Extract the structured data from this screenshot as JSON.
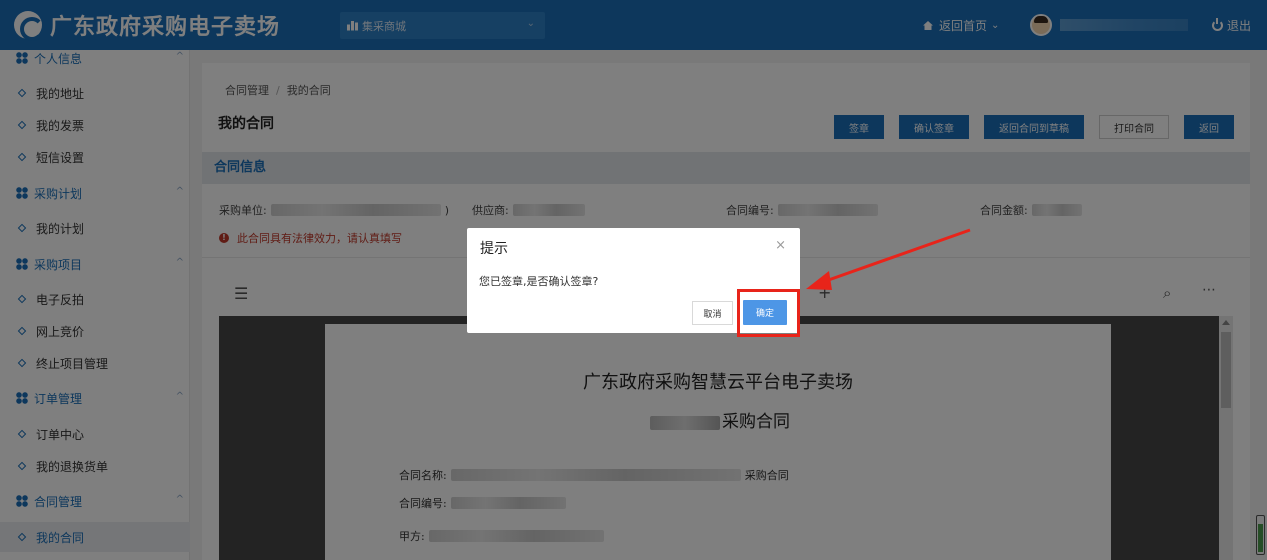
{
  "header": {
    "site_title": "广东政府采购电子卖场",
    "mall_select": "集采商城",
    "home_link": "返回首页",
    "logout": "退出"
  },
  "sidebar": {
    "groups": [
      {
        "label": "个人信息",
        "items": [
          "我的地址",
          "我的发票",
          "短信设置"
        ]
      },
      {
        "label": "采购计划",
        "items": [
          "我的计划"
        ]
      },
      {
        "label": "采购项目",
        "items": [
          "电子反拍",
          "网上竞价",
          "终止项目管理"
        ]
      },
      {
        "label": "订单管理",
        "items": [
          "订单中心",
          "我的退换货单"
        ]
      },
      {
        "label": "合同管理",
        "items": [
          "我的合同"
        ]
      }
    ],
    "active_item": "我的合同"
  },
  "main": {
    "breadcrumb": [
      "合同管理",
      "我的合同"
    ],
    "page_title": "我的合同",
    "buttons": [
      "签章",
      "确认签章",
      "返回合同到草稿",
      "打印合同",
      "返回"
    ],
    "section_title": "合同信息",
    "info": {
      "purchaser_label": "采购单位:",
      "supplier_label": "供应商:",
      "contract_no_label": "合同编号:",
      "amount_label": "合同金额:"
    },
    "warning": "此合同具有法律效力，请认真填写"
  },
  "pdf": {
    "title": "广东政府采购智慧云平台电子卖场",
    "subtitle_suffix": "采购合同",
    "fields": [
      "合同名称:",
      "合同编号:",
      "甲方:"
    ],
    "name_suffix": "采购合同"
  },
  "dialog": {
    "title": "提示",
    "message": "您已签章,是否确认签章?",
    "cancel": "取消",
    "confirm": "确定"
  },
  "colors": {
    "header": "#1a6fb9",
    "primary_button": "#1a6fb9",
    "confirm_button": "#4d96e6",
    "annotation": "#e8241a",
    "warning": "#c0392b"
  }
}
